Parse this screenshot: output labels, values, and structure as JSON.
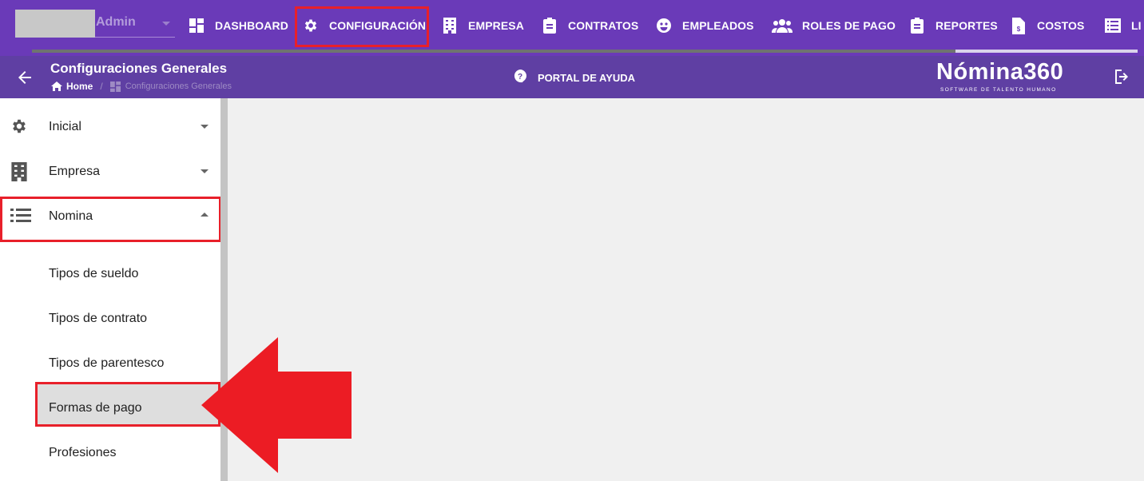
{
  "user": {
    "name": "Admin"
  },
  "nav": {
    "items": [
      {
        "label": "DASHBOARD",
        "icon": "dashboard-icon"
      },
      {
        "label": "CONFIGURACIÓN",
        "icon": "gear-icon"
      },
      {
        "label": "EMPRESA",
        "icon": "building-icon"
      },
      {
        "label": "CONTRATOS",
        "icon": "clipboard-icon"
      },
      {
        "label": "EMPLEADOS",
        "icon": "face-icon"
      },
      {
        "label": "ROLES DE PAGO",
        "icon": "group-icon"
      },
      {
        "label": "REPORTES",
        "icon": "clipboard-icon"
      },
      {
        "label": "COSTOS",
        "icon": "invoice-icon"
      },
      {
        "label": "LI",
        "icon": "list-icon"
      }
    ]
  },
  "header": {
    "title": "Configuraciones Generales",
    "breadcrumb": {
      "home": "Home",
      "current": "Configuraciones Generales"
    },
    "help_label": "PORTAL DE AYUDA",
    "brand_name": "Nómina360",
    "brand_tagline": "SOFTWARE DE TALENTO HUMANO"
  },
  "sidebar": {
    "items": [
      {
        "label": "Inicial",
        "icon": "gear-icon",
        "expanded": false
      },
      {
        "label": "Empresa",
        "icon": "building-icon",
        "expanded": false
      },
      {
        "label": "Nomina",
        "icon": "list-icon",
        "expanded": true
      }
    ],
    "sub_items": [
      {
        "label": "Tipos de sueldo"
      },
      {
        "label": "Tipos de contrato"
      },
      {
        "label": "Tipos de parentesco"
      },
      {
        "label": "Formas de pago",
        "active": true
      },
      {
        "label": "Profesiones"
      }
    ]
  },
  "colors": {
    "nav_bg": "#6a3ab8",
    "subheader_bg": "#5f3fa3",
    "highlight": "#e8202a"
  }
}
